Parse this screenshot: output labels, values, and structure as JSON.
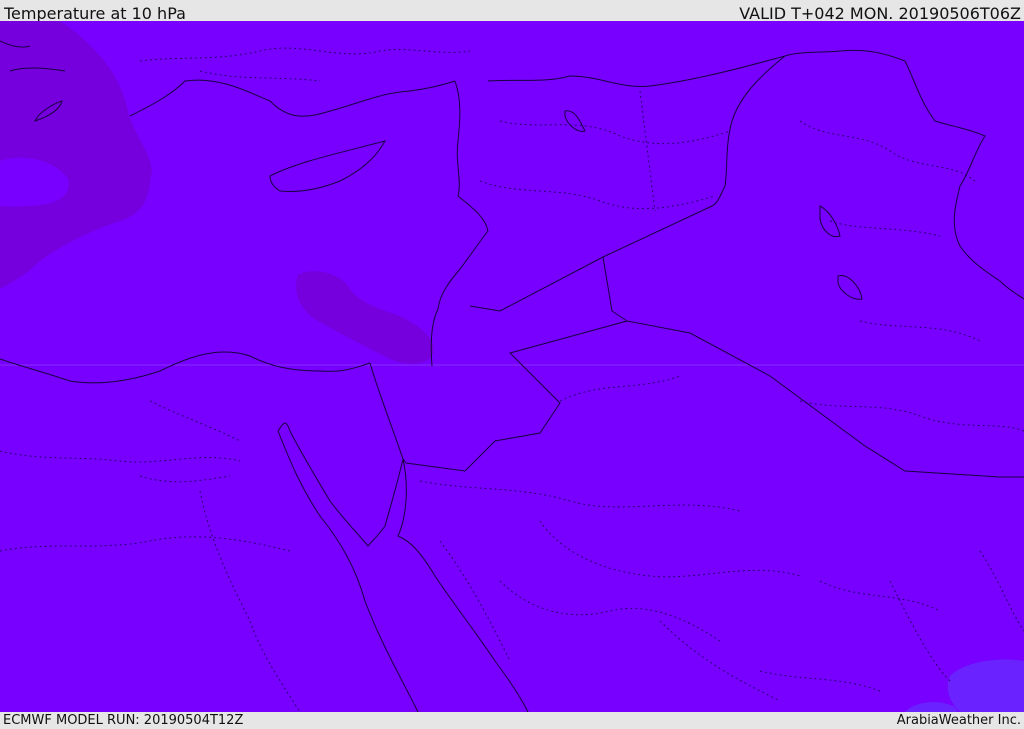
{
  "header": {
    "title": "Temperature at 10 hPa",
    "valid": "VALID T+042 MON. 20190506T06Z"
  },
  "footer": {
    "model_run": "ECMWF MODEL RUN: 20190504T12Z",
    "credit": "ArabiaWeather Inc."
  },
  "colors": {
    "field_main": "#7700ff",
    "field_warm": "#7400dd",
    "field_cool": "#6a22ff",
    "border": "#1a0040"
  }
}
